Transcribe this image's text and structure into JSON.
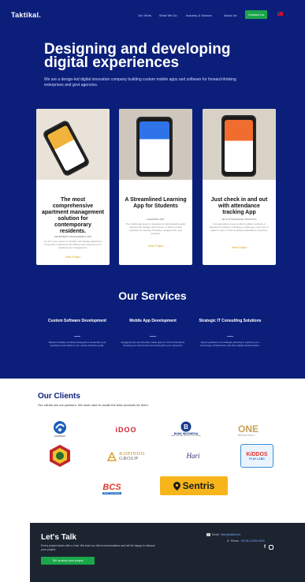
{
  "nav": {
    "logo": "Taktikal.",
    "links": [
      "Our Work",
      "What We Do",
      "Industry & Sectors",
      "About Us"
    ],
    "cta": "Contact Us"
  },
  "hero": {
    "title": "Designing and developing digital experiences",
    "subtitle": "We are a design-led digital innovation company building custom mobile apps and software for forward-thinking enterprises and govt agencies."
  },
  "cards": [
    {
      "title": "The most comprehensive apartment management solution for contemporary residents.",
      "meta": "APARTMENT MANAGEMENT APP",
      "text": "An all-in-one system to simplify and manage apartment living with a seamless and efficient user experience for residents and management.",
      "link": "View Project"
    },
    {
      "title": "A Streamlined Learning App for Students",
      "meta": "LEARNING APP",
      "text": "The mobile app layout is designed to help students easily access and manage their lessons. It offers a clean interface for viewing schedules, assignments, and progress.",
      "link": "View Project"
    },
    {
      "title": "Just check in and out with attendance tracking App",
      "meta": "HR & ATTENDANCE TRACKING",
      "text": "Our attendance system offers multiple methods of attendance tracking, including a mobile app, and more. It makes it easy to track employee attendance anywhere.",
      "link": "View Project"
    }
  ],
  "services": {
    "title": "Our Services",
    "items": [
      {
        "title": "Custom Software Development",
        "text": "Tailored software solutions designed to streamline your operations and achieve your unique business goals."
      },
      {
        "title": "Mobile App Development",
        "text": "Engaging and user-friendly mobile apps for iOS and Android, boosting your brand and connecting with your customers."
      },
      {
        "title": "Strategic IT Consulting Solutions",
        "text": "Expert guidance and strategic planning to optimize your technology infrastructure and drive digital transformation."
      }
    ]
  },
  "clients": {
    "title": "Our Clients",
    "subtitle": "Our clients are our partners. We work hard to create the best products for them.",
    "logos": {
      "kominfo": "KOMINFO",
      "idoo": "iDOO",
      "bi_name": "BANK INDONESIA",
      "bi_tag": "BANK SENTRAL REPUBLIK INDONESIA",
      "one_big": "ONE",
      "one_small": "BATAM MALL",
      "kopindo_top": "KOPINDO",
      "kopindo_bottom": "GROUP",
      "hari": "Hari",
      "kiddos_top": "KiDDOS",
      "kiddos_bottom": "PLAY LAND",
      "bcs": "BCS",
      "bcs_tag": "Batam City Square",
      "sentris": "Sentris"
    }
  },
  "footer": {
    "title": "Let's Talk",
    "text": "Every project starts with a chat. We lead our client conversations and will be happy to discuss your project.",
    "cta": "Tell us about your project",
    "email_label": "Email",
    "email": "hello@taktikal.id",
    "phone_label": "Phone",
    "phone": "+62 812-0000-0000"
  },
  "colors": {
    "primary": "#0b1f7a",
    "accent": "#1aa64a",
    "footer": "#1c2430",
    "link": "#d6a21a"
  }
}
